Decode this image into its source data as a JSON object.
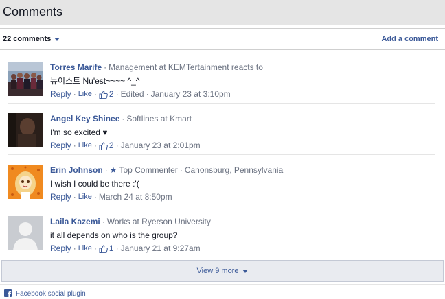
{
  "header": {
    "title": "Comments"
  },
  "toolbar": {
    "count_label": "22 comments",
    "add_comment_label": "Add a comment"
  },
  "actions": {
    "reply": "Reply",
    "like": "Like"
  },
  "comments": [
    {
      "author": "Torres Marife",
      "meta": "Management at KEMTertainment reacts to",
      "text": "뉴이스트 Nu'est~~~~ ^_^",
      "likes": "2",
      "edited": "Edited",
      "timestamp": "January 23 at 3:10pm",
      "avatar_icon": "group-photo-avatar"
    },
    {
      "author": "Angel Key Shinee",
      "meta": "Softlines at Kmart",
      "text": "I'm so excited ♥",
      "likes": "2",
      "timestamp": "January 23 at 2:01pm",
      "avatar_icon": "dark-photo-avatar"
    },
    {
      "author": "Erin Johnson",
      "badge": "Top Commenter",
      "meta": "Canonsburg, Pennsylvania",
      "text": "I wish I could be there :'(",
      "timestamp": "March 24 at 8:50pm",
      "avatar_icon": "cartoon-avatar"
    },
    {
      "author": "Laila Kazemi",
      "meta": "Works at Ryerson University",
      "text": "it all depends on who is the group?",
      "likes": "1",
      "timestamp": "January 21 at 9:27am",
      "avatar_icon": "default-silhouette-avatar"
    }
  ],
  "view_more": {
    "label": "View 9 more"
  },
  "footer": {
    "plugin_label": "Facebook social plugin"
  },
  "colors": {
    "link": "#3b5998",
    "meta": "#6a7180",
    "header_bg": "#e5e5e5",
    "view_more_bg": "#e9ebf0"
  }
}
